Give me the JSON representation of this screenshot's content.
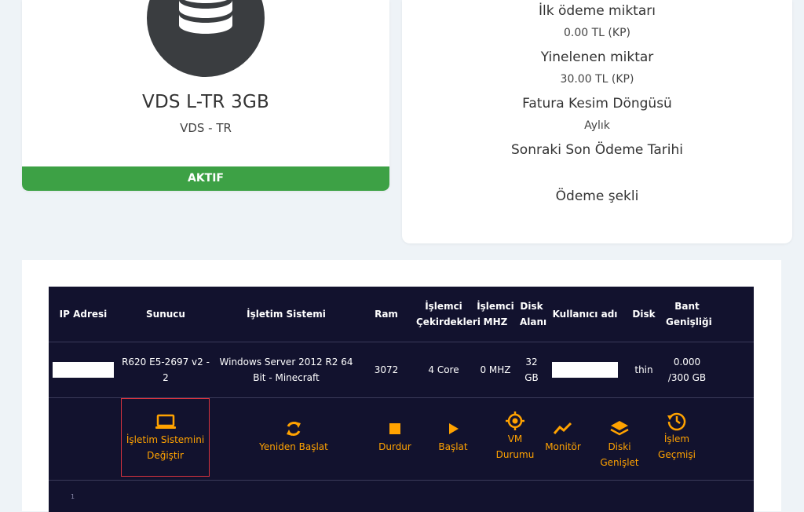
{
  "product": {
    "name": "VDS L-TR 3GB",
    "group": "VDS - TR",
    "status": "AKTIF",
    "icon": "database-icon"
  },
  "billing": {
    "first_payment_label": "İlk ödeme miktarı",
    "first_payment_value": "0.00 TL (KP)",
    "recurring_label": "Yinelenen miktar",
    "recurring_value": "30.00 TL (KP)",
    "cycle_label": "Fatura Kesim Döngüsü",
    "cycle_value": "Aylık",
    "next_due_label": "Sonraki Son Ödeme Tarihi",
    "next_due_value": "",
    "payment_method_label": "Ödeme şekli",
    "payment_method_value": ""
  },
  "table": {
    "headers": {
      "ip": "IP Adresi",
      "server": "Sunucu",
      "os": "İşletim Sistemi",
      "ram": "Ram",
      "cores": "İşlemci Çekirdekleri",
      "mhz": "İşlemci MHZ",
      "disk_size": "Disk Alanı",
      "username": "Kullanıcı adı",
      "disk": "Disk",
      "bandwidth": "Bant Genişliği"
    },
    "row": {
      "ip": "",
      "server": "R620 E5-2697 v2 - 2",
      "os": "Windows Server 2012 R2 64 Bit - Minecraft",
      "ram": "3072",
      "cores": "4 Core",
      "mhz": "0 MHZ",
      "disk_size": "32 GB",
      "username": "",
      "disk": "thin",
      "bandwidth": "0.000 /300 GB"
    }
  },
  "actions": {
    "change_os": "İşletim Sistemini Değiştir",
    "restart": "Yeniden Başlat",
    "stop": "Durdur",
    "start": "Başlat",
    "vm_status": "VM Durumu",
    "monitor": "Monitör",
    "disk_expand": "Diski Genişlet",
    "history": "İşlem Geçmişi"
  },
  "footer_mark": "1",
  "colors": {
    "table_bg": "#12122e",
    "action_color": "#ffa200",
    "status_green": "#3da145",
    "selected_border": "#d9333f"
  }
}
